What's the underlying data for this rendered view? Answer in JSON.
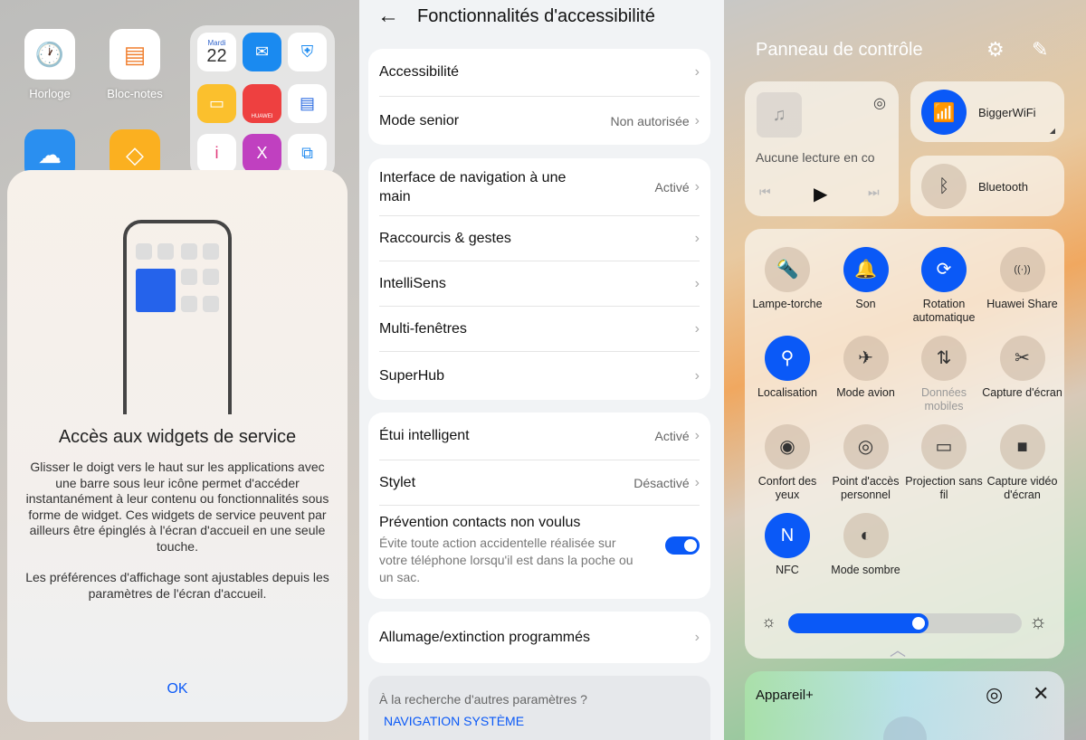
{
  "home": {
    "apps": [
      {
        "label": "Horloge",
        "icon": "clock-icon"
      },
      {
        "label": "Bloc-notes",
        "icon": "notes-icon"
      },
      {
        "label": "",
        "icon": "cloud-icon"
      },
      {
        "label": "",
        "icon": "diamond-icon"
      }
    ],
    "folder": {
      "calendar_day": "Mardi",
      "calendar_date": "22",
      "huawei_label": "HUAWEI"
    },
    "dialog": {
      "title": "Accès aux widgets de service",
      "body1": "Glisser le doigt vers le haut sur les applications avec une barre sous leur icône permet d'accéder instantanément à leur contenu ou fonctionnalités sous forme de widget. Ces widgets de service peuvent par ailleurs être épinglés à l'écran d'accueil en une seule touche.",
      "body2": "Les préférences d'affichage sont ajustables depuis les paramètres de l'écran d'accueil.",
      "ok": "OK"
    }
  },
  "settings": {
    "title": "Fonctionnalités d'accessibilité",
    "groups": [
      [
        {
          "label": "Accessibilité",
          "value": ""
        },
        {
          "label": "Mode senior",
          "value": "Non autorisée"
        }
      ],
      [
        {
          "label": "Interface de navigation à une main",
          "value": "Activé"
        },
        {
          "label": "Raccourcis & gestes",
          "value": ""
        },
        {
          "label": "IntelliSens",
          "value": ""
        },
        {
          "label": "Multi-fenêtres",
          "value": ""
        },
        {
          "label": "SuperHub",
          "value": ""
        }
      ],
      [
        {
          "label": "Étui intelligent",
          "value": "Activé"
        },
        {
          "label": "Stylet",
          "value": "Désactivé"
        },
        {
          "label": "Prévention contacts non voulus",
          "sub": "Évite toute action accidentelle réalisée sur votre téléphone lorsqu'il est dans la poche ou un sac.",
          "toggle": true
        }
      ],
      [
        {
          "label": "Allumage/extinction programmés",
          "value": ""
        }
      ]
    ],
    "footer": {
      "question": "À la recherche d'autres paramètres ?",
      "link": "NAVIGATION SYSTÈME"
    }
  },
  "control": {
    "title": "Panneau de contrôle",
    "media": {
      "text": "Aucune lecture en co"
    },
    "wifi": {
      "label": "BiggerWiFi",
      "on": true
    },
    "bluetooth": {
      "label": "Bluetooth",
      "on": false
    },
    "tiles": [
      {
        "label": "Lampe-torche",
        "icon": "flashlight-icon",
        "on": false
      },
      {
        "label": "Son",
        "icon": "bell-icon",
        "on": true
      },
      {
        "label": "Rotation automatique",
        "icon": "rotation-icon",
        "on": true
      },
      {
        "label": "Huawei Share",
        "icon": "share-icon",
        "on": false
      },
      {
        "label": "Localisation",
        "icon": "location-icon",
        "on": true
      },
      {
        "label": "Mode avion",
        "icon": "airplane-icon",
        "on": false
      },
      {
        "label": "Données mobiles",
        "icon": "mobile-data-icon",
        "on": false,
        "disabled": true
      },
      {
        "label": "Capture d'écran",
        "icon": "screenshot-icon",
        "on": false
      },
      {
        "label": "Confort des yeux",
        "icon": "eye-icon",
        "on": false
      },
      {
        "label": "Point d'accès personnel",
        "icon": "hotspot-icon",
        "on": false
      },
      {
        "label": "Projection sans fil",
        "icon": "cast-icon",
        "on": false
      },
      {
        "label": "Capture vidéo d'écran",
        "icon": "screen-record-icon",
        "on": false
      },
      {
        "label": "NFC",
        "icon": "nfc-icon",
        "on": true
      },
      {
        "label": "Mode sombre",
        "icon": "dark-mode-icon",
        "on": false
      }
    ],
    "brightness_percent": 60,
    "device_plus": {
      "title": "Appareil+"
    },
    "accent": "#0a59f7"
  }
}
